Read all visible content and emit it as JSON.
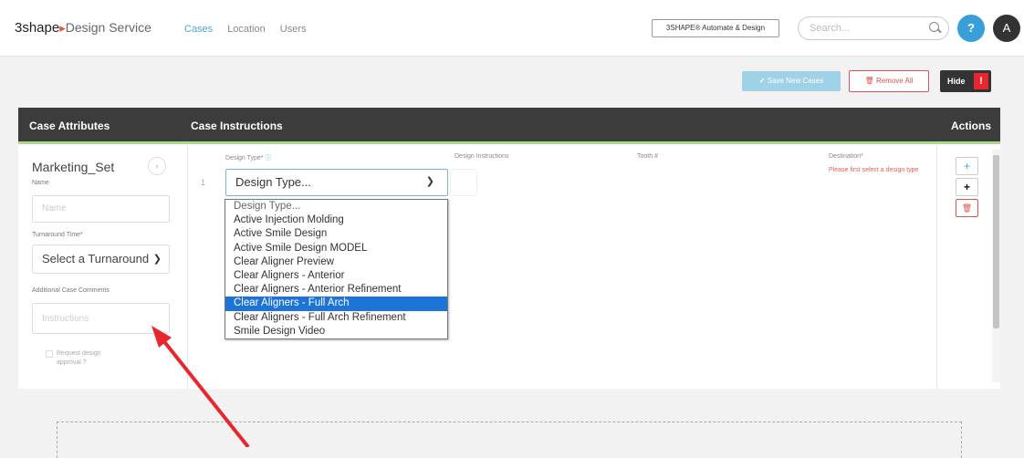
{
  "brand": {
    "name_part1": "3shape",
    "arrow": "▸",
    "name_part2": "Design Service"
  },
  "nav": {
    "items": [
      "Cases",
      "Location",
      "Users"
    ]
  },
  "header_badge": "3SHAPE® Automate & Design",
  "search": {
    "placeholder": "Search..."
  },
  "help_icon": "?",
  "avatar_initial": "A",
  "toolbar": {
    "save_label": "✔ Save New Cases",
    "remove_label": "🗑 Remove All",
    "hide_label": "Hide",
    "hide_badge": "!"
  },
  "table_header": {
    "attributes": "Case Attributes",
    "instructions": "Case Instructions",
    "actions": "Actions"
  },
  "case": {
    "name": "Marketing_Set",
    "collapse_icon": "‹",
    "name_label": "Name",
    "name_placeholder": "Name",
    "turnaround_label": "Turnaround Time*",
    "turnaround_value": "Select a Turnaround",
    "comments_label": "Additional Case Comments",
    "comments_placeholder": "Instructions",
    "checkbox_line1": "Request design",
    "checkbox_line2": "approval ?"
  },
  "instructions": {
    "design_type_label": "Design Type*",
    "design_instructions_label": "Design Instructions",
    "tooth_label": "Tooth #",
    "destination_label": "Destination*",
    "row_number": "1",
    "design_type_selected": "Design Type...",
    "destination_note": "Please first select a design type",
    "options": [
      "Design Type...",
      "Active Injection Molding",
      "Active Smile Design",
      "Active Smile Design MODEL",
      "Clear Aligner Preview",
      "Clear Aligners - Anterior",
      "Clear Aligners - Anterior Refinement",
      "Clear Aligners - Full Arch",
      "Clear Aligners - Full Arch Refinement",
      "Smile Design Video"
    ],
    "highlighted_option": "Clear Aligners - Full Arch"
  },
  "actions": {
    "add_icon": "+",
    "add_black_icon": "+",
    "delete_icon": "🗑"
  },
  "colors": {
    "accent_blue": "#3a9fd8",
    "header_dark": "#3c3c3c",
    "highlight": "#1e73d8",
    "alert_red": "#e8262d",
    "arrow_red": "#e8262d"
  }
}
